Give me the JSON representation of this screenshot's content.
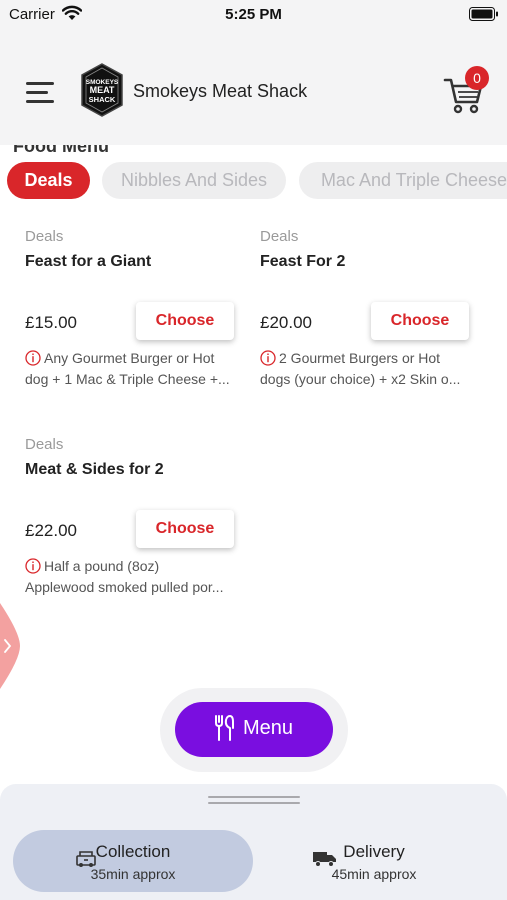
{
  "status_bar": {
    "carrier": "Carrier",
    "time": "5:25 PM"
  },
  "header": {
    "app_name": "Smokeys Meat Shack",
    "logo_lines": [
      "SMOKEYS",
      "MEAT",
      "SHACK"
    ],
    "cart_count": "0"
  },
  "section": {
    "title": "Food Menu"
  },
  "tabs": [
    {
      "label": "Deals",
      "active": true
    },
    {
      "label": "Nibbles And Sides",
      "active": false
    },
    {
      "label": "Mac And Triple Cheese",
      "active": false
    }
  ],
  "products": [
    {
      "category": "Deals",
      "name": "Feast for a Giant",
      "price": "£15.00",
      "button": "Choose",
      "desc_line1": "Any Gourmet Burger or Hot",
      "desc_line2": "dog + 1 Mac & Triple Cheese +..."
    },
    {
      "category": "Deals",
      "name": "Feast For 2",
      "price": "£20.00",
      "button": "Choose",
      "desc_line1": "2 Gourmet Burgers or Hot",
      "desc_line2": "dogs (your choice) + x2 Skin o..."
    },
    {
      "category": "Deals",
      "name": "Meat & Sides for 2",
      "price": "£22.00",
      "button": "Choose",
      "desc_line1": "Half a pound (8oz)",
      "desc_line2": "Applewood smoked pulled por..."
    }
  ],
  "menu_button": {
    "label": "Menu"
  },
  "order_options": [
    {
      "title": "Collection",
      "subtitle": "35min approx",
      "active": true,
      "icon": "collection-icon"
    },
    {
      "title": "Delivery",
      "subtitle": "45min approx",
      "active": false,
      "icon": "delivery-truck-icon"
    }
  ],
  "colors": {
    "accent_red": "#d9262a",
    "menu_purple": "#7a0ee0",
    "active_option": "#c2cbe0"
  }
}
